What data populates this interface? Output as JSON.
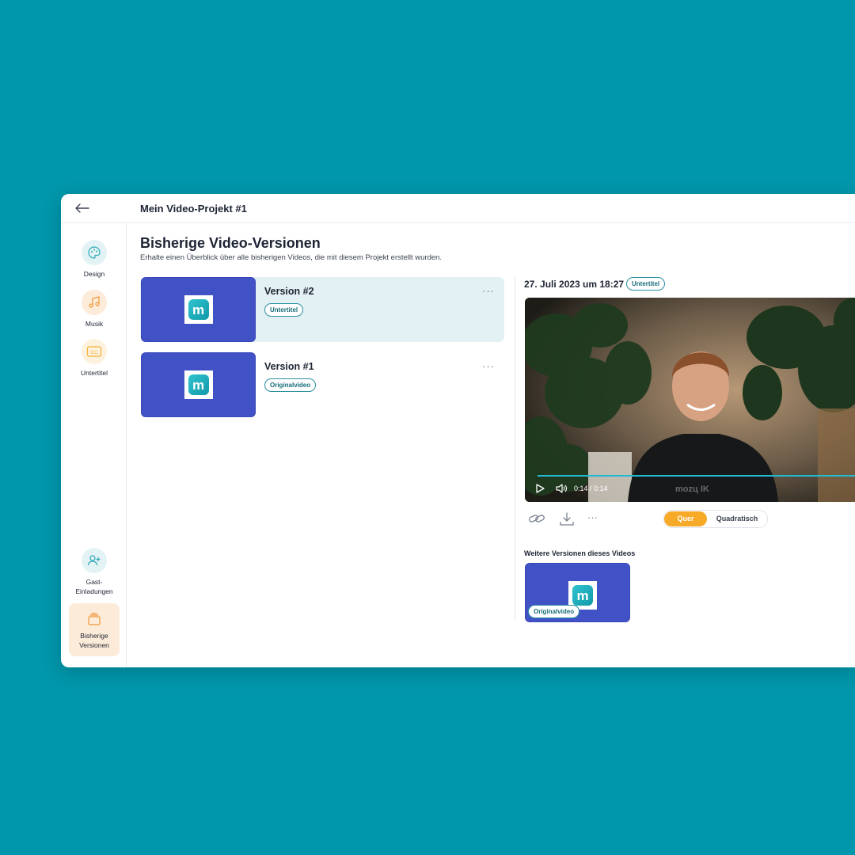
{
  "header": {
    "title": "Mein Video-Projekt #1"
  },
  "sidebar": {
    "items": [
      {
        "label": "Design",
        "icon": "palette-icon",
        "color": "#2aa8b8",
        "bg": "#e3f3f5"
      },
      {
        "label": "Musik",
        "icon": "music-note-icon",
        "color": "#f0973a",
        "bg": "#fdebd9"
      },
      {
        "label": "Untertitel",
        "icon": "cc-icon",
        "color": "#f5b13b",
        "bg": "#fdf2de"
      }
    ],
    "bottom_items": [
      {
        "label_line1": "Gast-",
        "label_line2": "Einladungen",
        "icon": "add-user-icon"
      },
      {
        "label_line1": "Bisherige",
        "label_line2": "Versionen",
        "icon": "stack-icon",
        "active": true
      }
    ]
  },
  "main": {
    "title": "Bisherige Video-Versionen",
    "subtitle": "Erhalte einen Überblick über alle bisherigen Videos, die mit diesem Projekt erstellt wurden.",
    "versions": [
      {
        "name": "Version #2",
        "badge": "Untertitel",
        "active": true
      },
      {
        "name": "Version #1",
        "badge": "Originalvideo",
        "active": false
      }
    ]
  },
  "detail": {
    "date": "27. Juli 2023 um 18:27",
    "badge": "Untertitel",
    "player": {
      "time": "0:14 / 0:14",
      "progress": 1.0,
      "watermark": "mozц IK"
    },
    "format_toggle": {
      "options": [
        "Quer",
        "Quadratisch"
      ],
      "selected": "Quer"
    },
    "more_versions_title": "Weitere Versionen dieses Videos",
    "more_versions": [
      {
        "badge": "Originalvideo"
      }
    ]
  },
  "colors": {
    "background": "#0096ab",
    "accent_orange": "#f7a928",
    "thumb_blue": "#4152c6",
    "teal": "#2a8f9f"
  },
  "logo": {
    "letter": "m"
  }
}
